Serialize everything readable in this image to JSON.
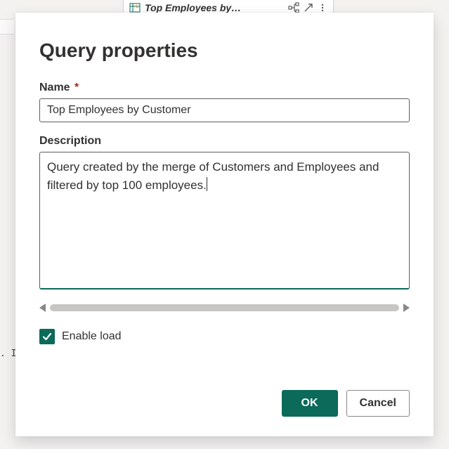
{
  "background": {
    "tab_title": "Top Employees by…",
    "leftbar_text": ". I"
  },
  "dialog": {
    "title": "Query properties",
    "name": {
      "label": "Name",
      "required_marker": "*",
      "value": "Top Employees by Customer"
    },
    "description": {
      "label": "Description",
      "value": "Query created by the merge of Customers and Employees and filtered by top 100 employees."
    },
    "enable_load": {
      "label": "Enable load",
      "checked": true
    },
    "buttons": {
      "ok": "OK",
      "cancel": "Cancel"
    }
  }
}
